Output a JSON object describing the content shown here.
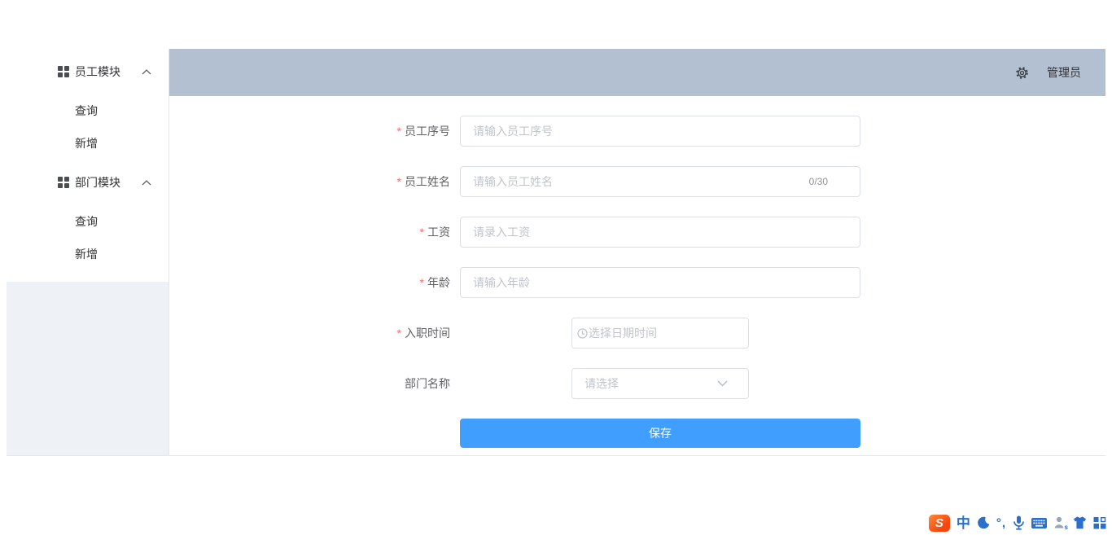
{
  "colors": {
    "header_bg": "#b3c0d1",
    "aside_bg": "#eef1f6",
    "primary_blue": "#409eff",
    "required_red": "#f56c6c",
    "placeholder_gray": "#c0c4cc",
    "ime_blue": "#2a6fc9",
    "ime_orange": "#f4470f"
  },
  "sidebar": {
    "groups": [
      {
        "title": "员工模块",
        "items": [
          {
            "label": "查询"
          },
          {
            "label": "新增"
          }
        ]
      },
      {
        "title": "部门模块",
        "items": [
          {
            "label": "查询"
          },
          {
            "label": "新增"
          }
        ]
      }
    ]
  },
  "header": {
    "user": "管理员"
  },
  "form": {
    "required_mark": "*",
    "fields": [
      {
        "label": "员工序号",
        "required": true,
        "placeholder": "请输入员工序号",
        "type": "text"
      },
      {
        "label": "员工姓名",
        "required": true,
        "placeholder": "请输入员工姓名",
        "counter": "0/30",
        "type": "text"
      },
      {
        "label": "工资",
        "required": true,
        "placeholder": "请录入工资",
        "type": "text"
      },
      {
        "label": "年龄",
        "required": true,
        "placeholder": "请输入年龄",
        "type": "text"
      },
      {
        "label": "入职时间",
        "required": true,
        "placeholder": "选择日期时间",
        "type": "datetime"
      },
      {
        "label": "部门名称",
        "required": false,
        "placeholder": "请选择",
        "type": "select"
      }
    ],
    "save_label": "保存"
  },
  "taskbar": {
    "ime_name": "Sogou",
    "logo_letter": "S",
    "zh_mode_glyph": "中",
    "punctuation_glyph": "°,",
    "skin_badge": "s"
  }
}
